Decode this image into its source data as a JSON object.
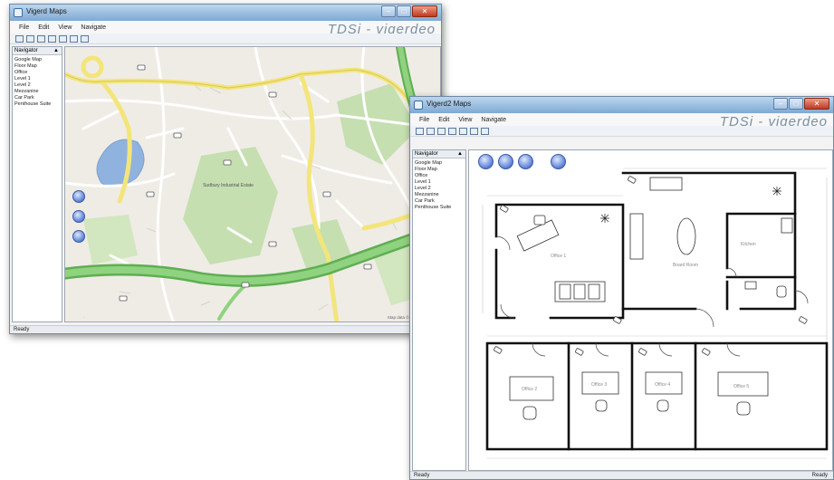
{
  "window1": {
    "title": "Vigerd Maps",
    "menu": [
      "File",
      "Edit",
      "View",
      "Navigate"
    ],
    "brand": "TDSi - vigerdeo",
    "nav_title": "Navigator",
    "nav_pin": "▲",
    "nav_items": [
      "Google Map",
      "Floor Map",
      "Office",
      "Level 1",
      "Level 2",
      "Mezzanine",
      "Car Park",
      "Penthouse Suite"
    ],
    "status": "Ready",
    "map_labels": {
      "park": "Sudbury Industrial Estate",
      "copyright": "Map data ©2010 Tele Atlas"
    }
  },
  "window2": {
    "title": "Vigerd2 Maps",
    "menu": [
      "File",
      "Edit",
      "View",
      "Navigate"
    ],
    "brand": "TDSi - vigerdeo",
    "nav_title": "Navigator",
    "nav_pin": "▲",
    "nav_items": [
      "Google Map",
      "Floor Map",
      "Office",
      "Level 1",
      "Level 2",
      "Mezzanine",
      "Car Park",
      "Penthouse Suite"
    ],
    "status_left": "Ready",
    "status_right": "Ready",
    "rooms": {
      "office1": "Office 1",
      "board": "Board Room",
      "kitchen": "Kitchen",
      "office2": "Office 2",
      "office3": "Office 3",
      "office4": "Office 4",
      "office5": "Office 5"
    }
  },
  "icons": {
    "window": "app-window-icon",
    "minimize": "minimize-icon",
    "maximize": "maximize-icon",
    "close": "close-icon",
    "zoom": "zoom-control-icon",
    "camera": "camera-icon"
  },
  "colors": {
    "titlebar": "#7ea9d3",
    "road_major": "#7fc46f",
    "road_minor": "#f3e57a",
    "water": "#8fb3de",
    "park": "#c5dfb0",
    "zoom": "#5b7fd6"
  }
}
